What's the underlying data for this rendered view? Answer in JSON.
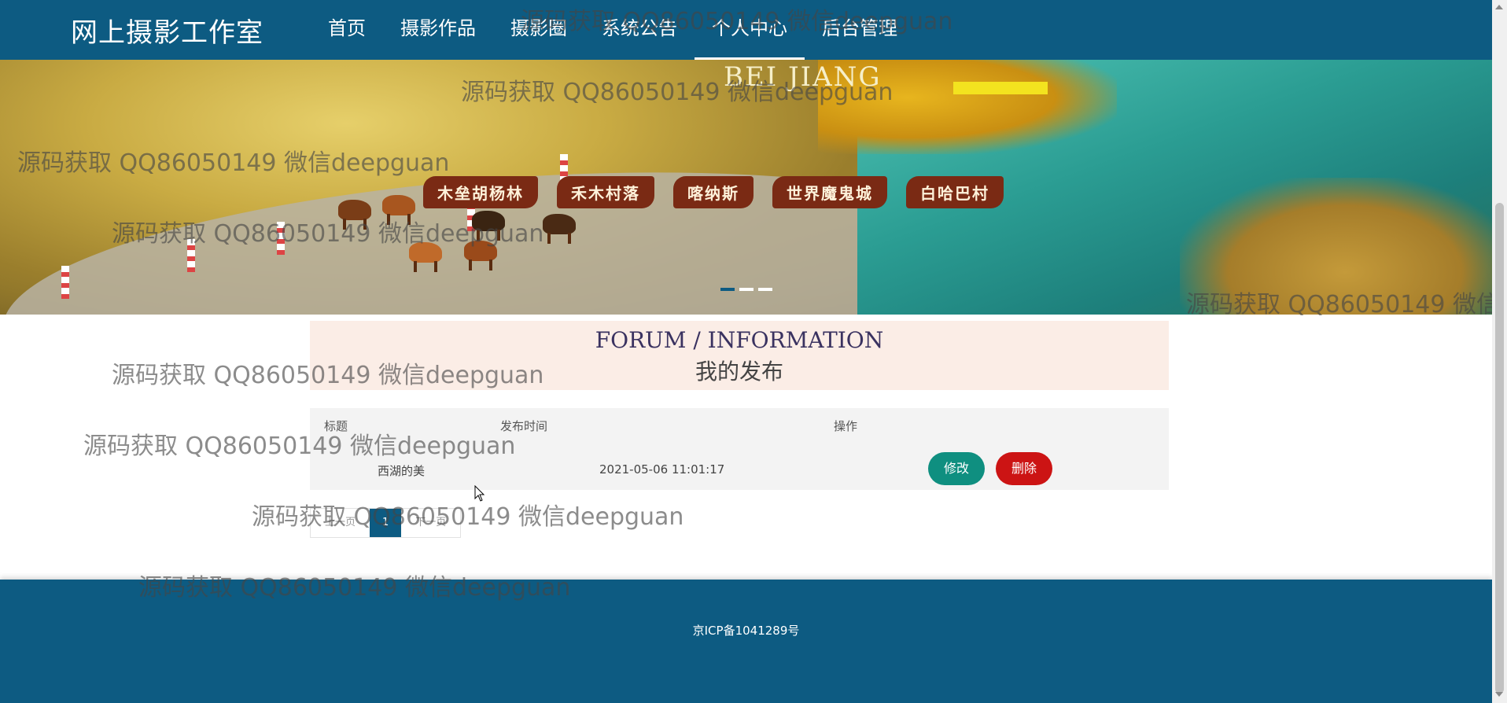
{
  "header": {
    "brand": "网上摄影工作室",
    "nav": [
      {
        "label": "首页",
        "active": false
      },
      {
        "label": "摄影作品",
        "active": false
      },
      {
        "label": "摄影圈",
        "active": false
      },
      {
        "label": "系统公告",
        "active": false
      },
      {
        "label": "个人中心",
        "active": true
      },
      {
        "label": "后台管理",
        "active": false
      }
    ]
  },
  "banner": {
    "subtitle": "BEI JIANG",
    "tags": [
      "木垒胡杨林",
      "禾木村落",
      "喀纳斯",
      "世界魔鬼城",
      "白哈巴村"
    ],
    "slide_count": 3,
    "active_slide": 1
  },
  "section": {
    "title_en": "FORUM / INFORMATION",
    "title_cn": "我的发布"
  },
  "table": {
    "headers": [
      "标题",
      "发布时间",
      "操作"
    ],
    "rows": [
      {
        "title": "西湖的美",
        "time": "2021-05-06 11:01:17",
        "edit_label": "修改",
        "delete_label": "删除"
      }
    ]
  },
  "pagination": {
    "prev": "上一页",
    "current": "1",
    "next": "下一页"
  },
  "footer": {
    "icp": "京ICP备1041289号"
  },
  "watermark": "源码获取 QQ86050149 微信deepguan",
  "colors": {
    "primary": "#0d5b82",
    "edit": "#0f8f80",
    "delete": "#cc1414",
    "title_bg": "#fbede6"
  }
}
